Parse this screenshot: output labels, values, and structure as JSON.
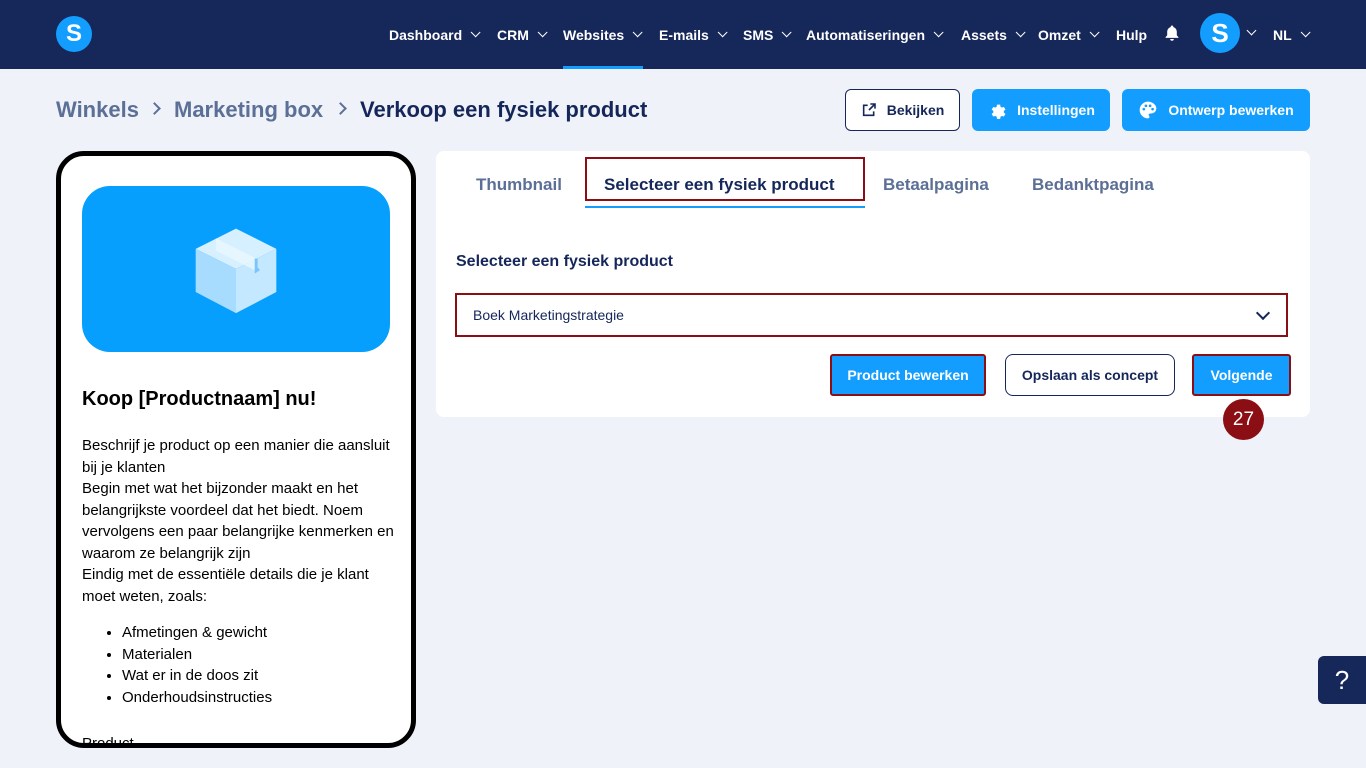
{
  "nav": {
    "logo": "S",
    "items": [
      {
        "label": "Dashboard"
      },
      {
        "label": "CRM"
      },
      {
        "label": "Websites"
      },
      {
        "label": "E-mails"
      },
      {
        "label": "SMS"
      },
      {
        "label": "Automatiseringen"
      },
      {
        "label": "Assets"
      },
      {
        "label": "Omzet"
      },
      {
        "label": "Hulp"
      }
    ],
    "active": "Websites",
    "avatar": "S",
    "language": "NL"
  },
  "breadcrumb": {
    "items": [
      "Winkels",
      "Marketing box"
    ],
    "current": "Verkoop een fysiek product"
  },
  "header_buttons": {
    "view": "Bekijken",
    "settings": "Instellingen",
    "design": "Ontwerp bewerken"
  },
  "preview": {
    "title": "Koop [Productnaam] nu!",
    "paragraphs": [
      "Beschrijf je product op een manier die aansluit bij je klanten",
      "Begin met wat het bijzonder maakt en het belangrijkste voordeel dat het biedt. Noem vervolgens een paar belangrijke kenmerken en waarom ze belangrijk zijn",
      "Eindig met de essentiële details die je klant moet weten, zoals:"
    ],
    "list": [
      "Afmetingen & gewicht",
      "Materialen",
      "Wat er in de doos zit",
      "Onderhoudsinstructies"
    ],
    "footer": "Product"
  },
  "tabs": [
    {
      "label": "Thumbnail"
    },
    {
      "label": "Selecteer een fysiek product"
    },
    {
      "label": "Betaalpagina"
    },
    {
      "label": "Bedanktpagina"
    }
  ],
  "form": {
    "label": "Selecteer een fysiek product",
    "selected_product": "Boek Marketingstrategie",
    "edit_product": "Product bewerken",
    "save_draft": "Opslaan als concept",
    "next": "Volgende"
  },
  "step_badge": "27",
  "help": "?",
  "colors": {
    "navy": "#16275a",
    "accent": "#139eff",
    "highlight": "#8b0e14"
  }
}
